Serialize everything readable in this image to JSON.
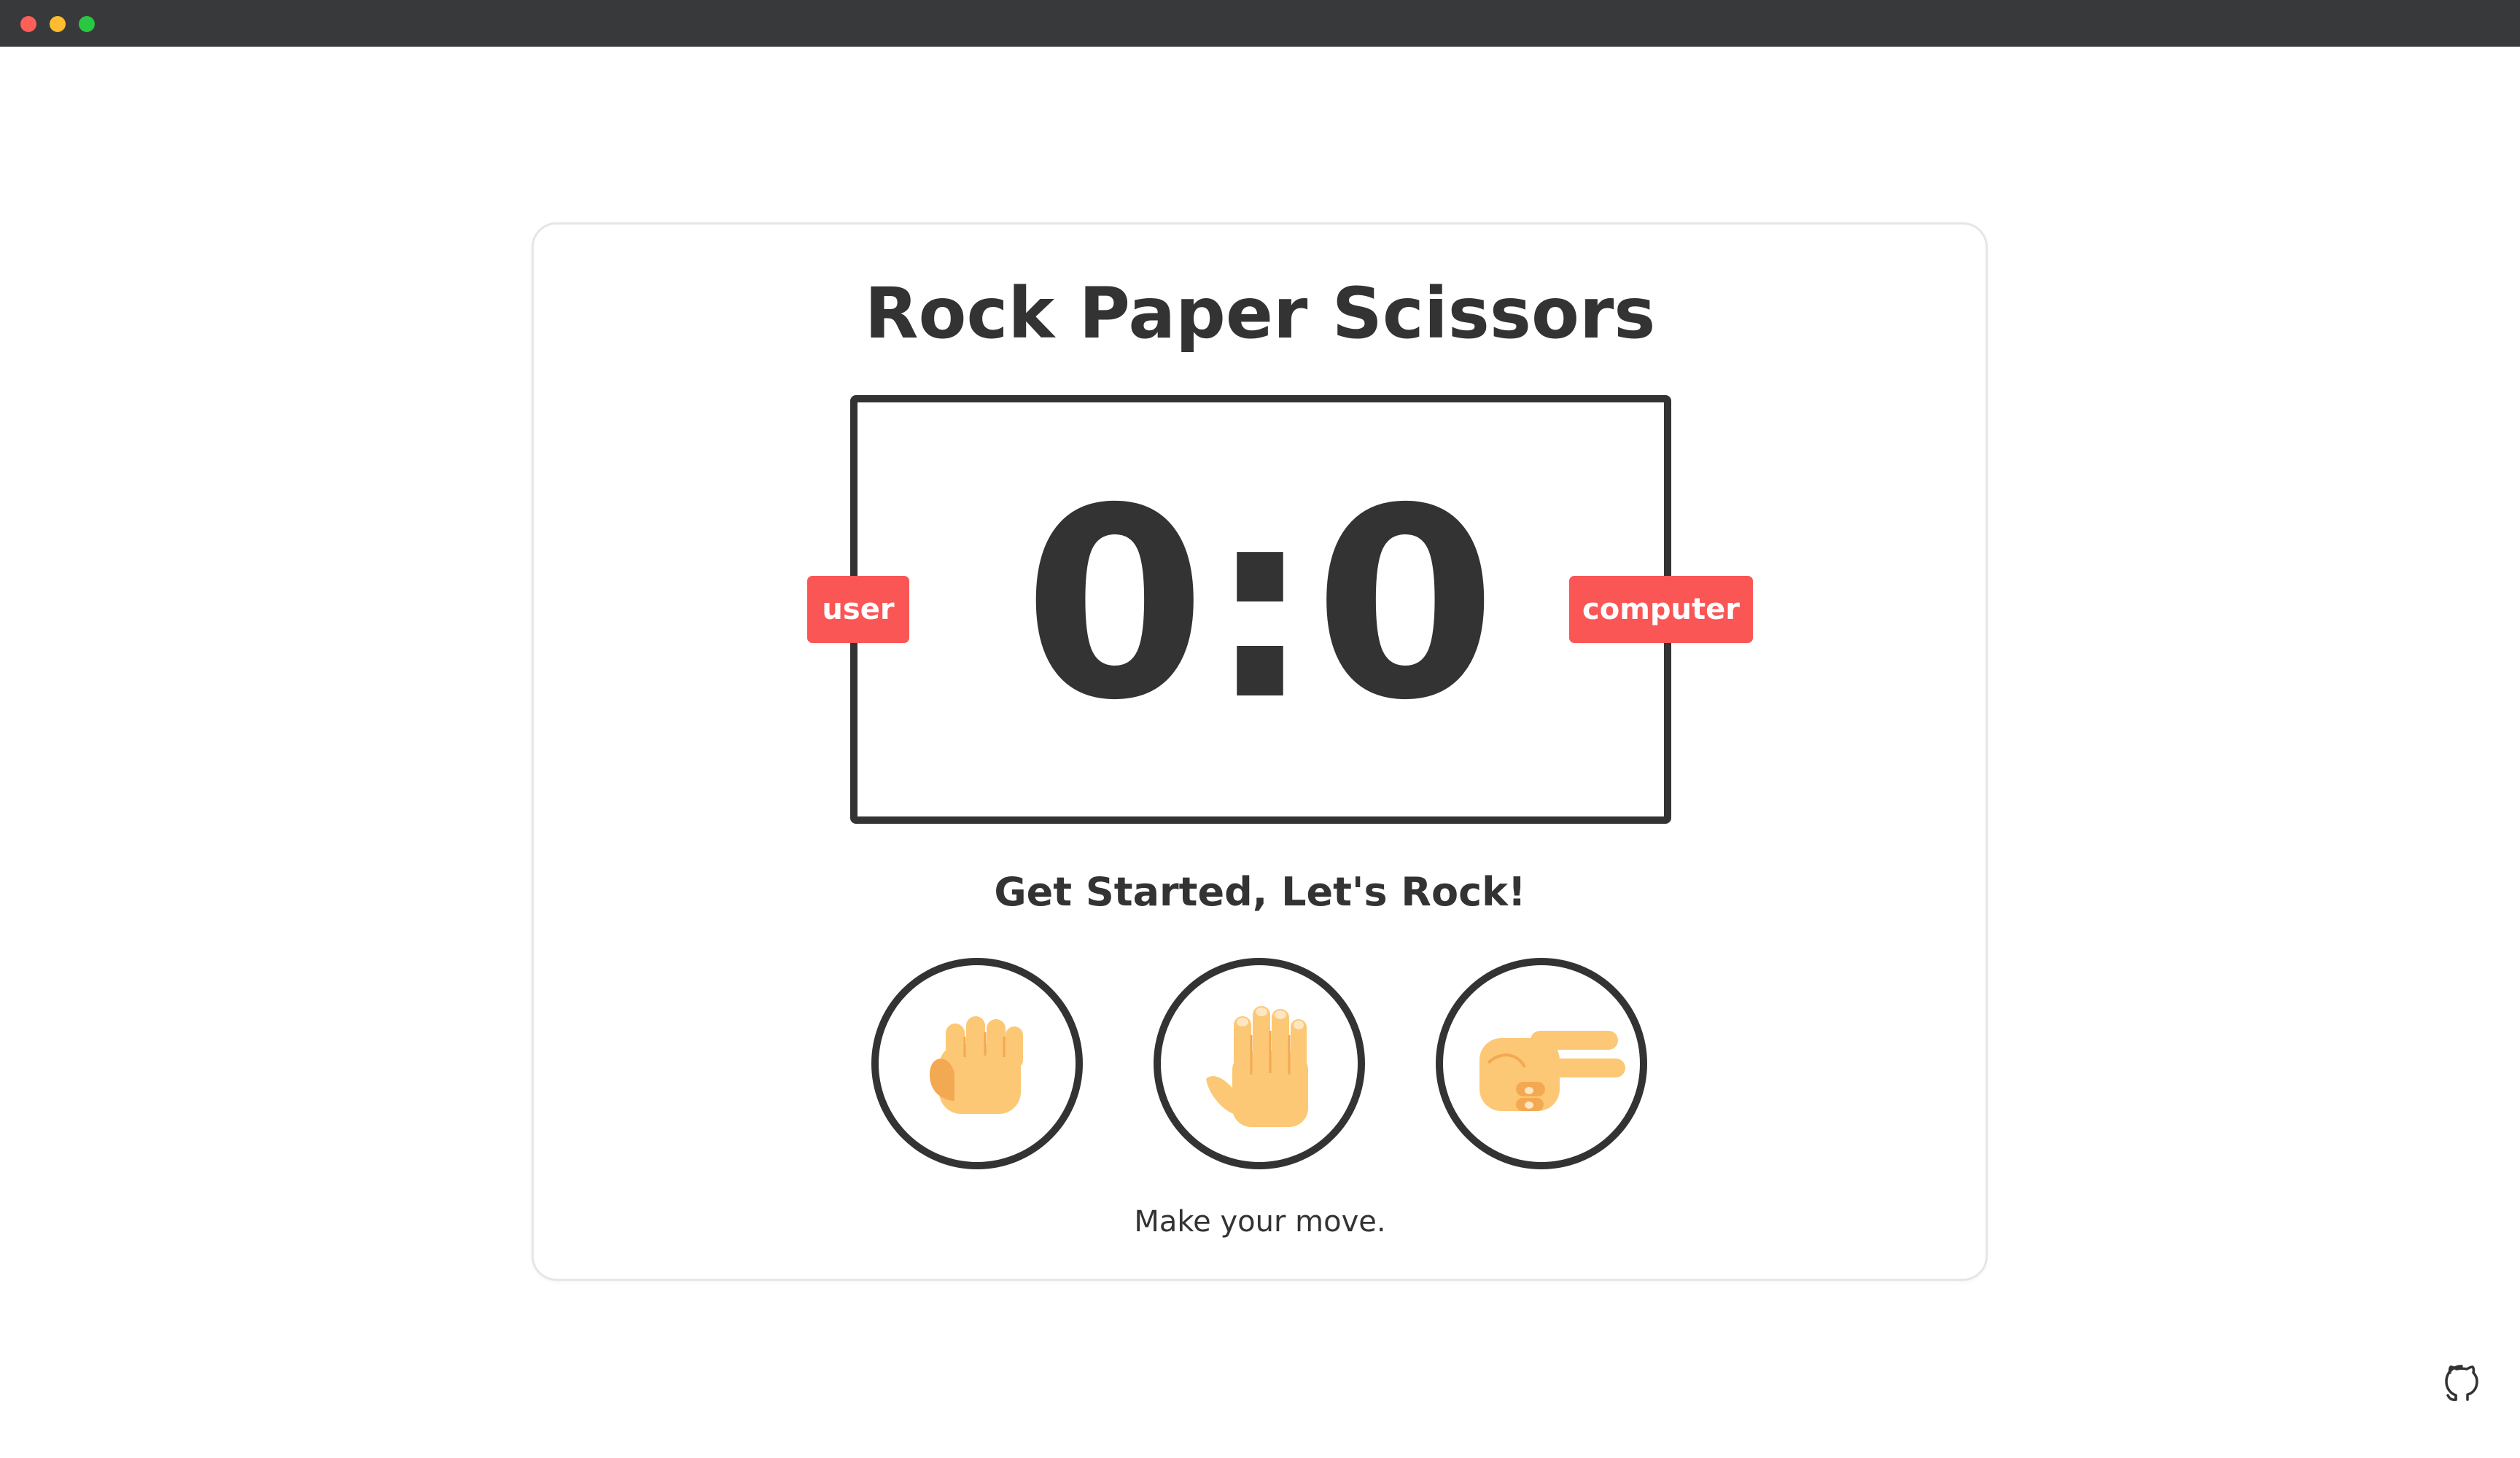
{
  "window": {
    "controls": [
      "close",
      "minimize",
      "maximize"
    ]
  },
  "game": {
    "title": "Rock Paper Scissors",
    "score": "0:0",
    "user_label": "user",
    "computer_label": "computer",
    "message": "Get Started, Let's Rock!",
    "action_text": "Make your move.",
    "choices": [
      {
        "name": "rock",
        "icon": "fist-hand-icon"
      },
      {
        "name": "paper",
        "icon": "raised-hand-icon"
      },
      {
        "name": "scissors",
        "icon": "victory-hand-icon"
      }
    ]
  },
  "footer": {
    "icon": "github-icon"
  },
  "colors": {
    "text": "#333333",
    "badge": "#fa5656",
    "skin": "#fcc875",
    "skin_shade": "#f3a952",
    "titlebar": "#38393b"
  }
}
